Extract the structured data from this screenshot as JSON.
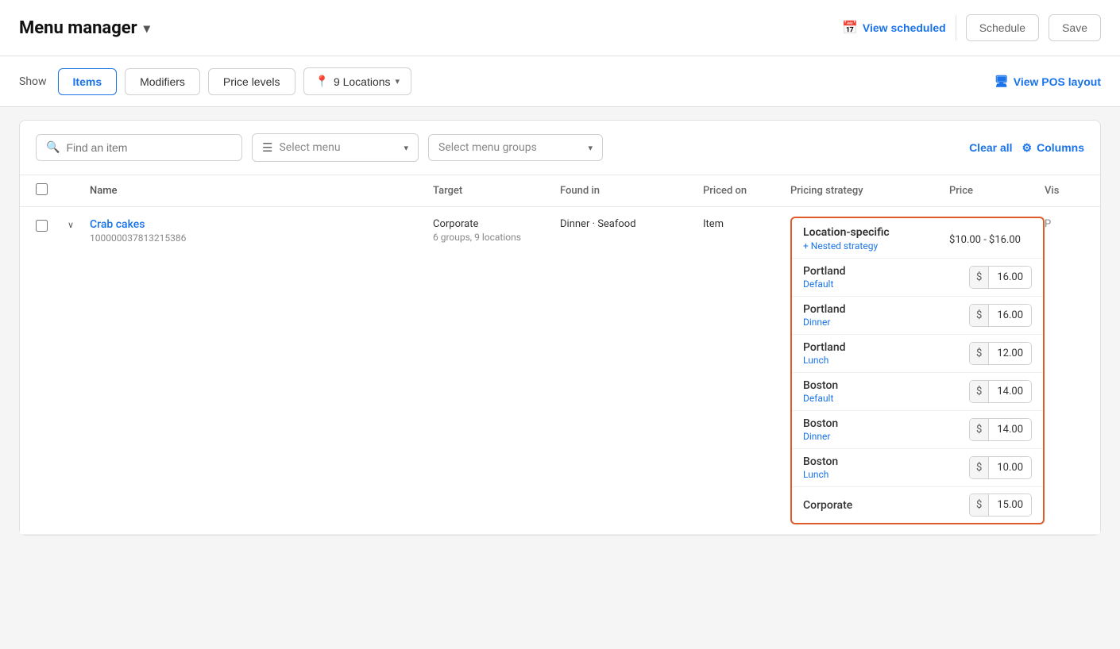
{
  "header": {
    "title": "Menu manager",
    "dropdown_arrow": "▾",
    "view_scheduled_label": "View scheduled",
    "schedule_label": "Schedule",
    "save_label": "Save"
  },
  "toolbar": {
    "show_label": "Show",
    "tabs": [
      {
        "id": "items",
        "label": "Items",
        "active": true
      },
      {
        "id": "modifiers",
        "label": "Modifiers",
        "active": false
      },
      {
        "id": "price_levels",
        "label": "Price levels",
        "active": false
      }
    ],
    "locations_label": "9 Locations",
    "view_pos_label": "View POS layout"
  },
  "filters": {
    "search_placeholder": "Find an item",
    "select_menu_placeholder": "Select menu",
    "select_groups_placeholder": "Select menu groups",
    "clear_all_label": "Clear all",
    "columns_label": "Columns"
  },
  "table": {
    "columns": [
      "Name",
      "Target",
      "Found in",
      "Priced on",
      "Pricing strategy",
      "Price",
      "Vis"
    ],
    "rows": [
      {
        "name": "Crab cakes",
        "id": "100000037813215386",
        "target_main": "Corporate",
        "target_sub": "6 groups, 9 locations",
        "found_in": "Dinner · Seafood",
        "priced_on": "Item",
        "pricing_strategy": "Location-specific",
        "nested_label": "+ Nested strategy",
        "price_range": "$10.00 - $16.00",
        "vis": "P",
        "location_prices": [
          {
            "location": "Portland",
            "sub": "Default",
            "price": "16.00"
          },
          {
            "location": "Portland",
            "sub": "Dinner",
            "price": "16.00"
          },
          {
            "location": "Portland",
            "sub": "Lunch",
            "price": "12.00"
          },
          {
            "location": "Boston",
            "sub": "Default",
            "price": "14.00"
          },
          {
            "location": "Boston",
            "sub": "Dinner",
            "price": "14.00"
          },
          {
            "location": "Boston",
            "sub": "Lunch",
            "price": "10.00"
          },
          {
            "location": "Corporate",
            "sub": "",
            "price": "15.00"
          }
        ]
      }
    ]
  },
  "icons": {
    "search": "🔍",
    "menu_lines": "≡",
    "location_pin": "📍",
    "monitor": "🖥",
    "calendar": "📅",
    "gear": "⚙",
    "chevron_down": "▾",
    "arrow_right": "›",
    "arrow_down": "∨",
    "dollar": "$"
  },
  "colors": {
    "accent_blue": "#1a73e8",
    "orange_border": "#e05b2a",
    "text_dark": "#333",
    "text_light": "#888",
    "border": "#d0d0d0"
  }
}
